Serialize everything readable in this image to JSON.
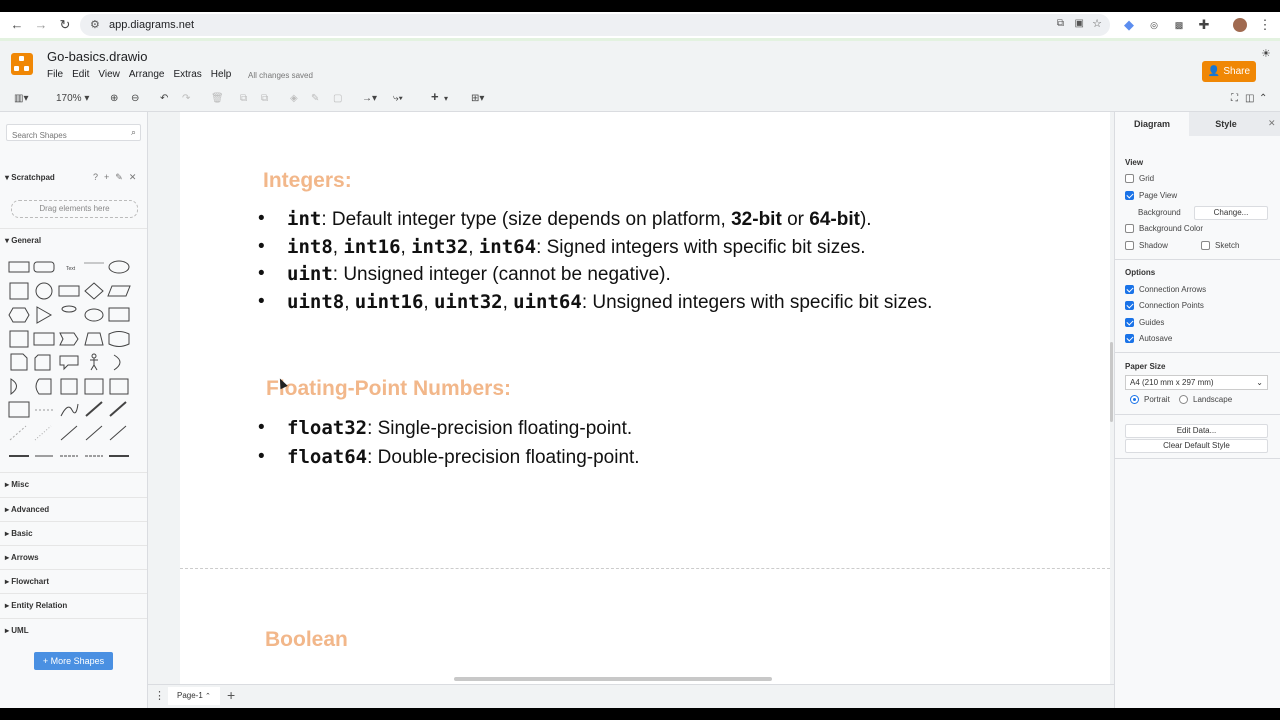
{
  "browser": {
    "url": "app.diagrams.net"
  },
  "app": {
    "doc_title": "Go-basics.drawio",
    "menu": [
      "File",
      "Edit",
      "View",
      "Arrange",
      "Extras",
      "Help"
    ],
    "save_status": "All changes saved",
    "share_label": "Share"
  },
  "toolbar": {
    "zoom": "170%"
  },
  "left": {
    "search_placeholder": "Search Shapes",
    "scratchpad": "Scratchpad",
    "drop_hint": "Drag elements here",
    "general": "General",
    "sections": [
      "Misc",
      "Advanced",
      "Basic",
      "Arrows",
      "Flowchart",
      "Entity Relation",
      "UML"
    ],
    "more_shapes": "More Shapes"
  },
  "doc": {
    "integers_heading": "Integers:",
    "int": {
      "code": "int",
      "text1": ": Default integer type (size depends on platform, ",
      "bold1": "32-bit",
      "text2": " or ",
      "bold2": "64-bit",
      "text3": ")."
    },
    "signed": {
      "c1": "int8",
      "c2": "int16",
      "c3": "int32",
      "c4": "int64",
      "sep": ", ",
      "text": ": Signed integers with specific bit sizes."
    },
    "uint": {
      "code": "uint",
      "text": ": Unsigned integer (cannot be negative)."
    },
    "unsigned": {
      "c1": "uint8",
      "c2": "uint16",
      "c3": "uint32",
      "c4": "uint64",
      "sep": ", ",
      "text": ": Unsigned integers with specific bit sizes."
    },
    "float_heading": "Floating-Point Numbers:",
    "float32": {
      "code": "float32",
      "text": ": Single-precision floating-point."
    },
    "float64": {
      "code": "float64",
      "text": ": Double-precision floating-point."
    },
    "boolean_heading": "Boolean"
  },
  "bottom": {
    "page_tab": "Page-1"
  },
  "right": {
    "tab_diagram": "Diagram",
    "tab_style": "Style",
    "view_label": "View",
    "grid": "Grid",
    "page_view": "Page View",
    "background": "Background",
    "change": "Change...",
    "background_color": "Background Color",
    "shadow": "Shadow",
    "sketch": "Sketch",
    "options_label": "Options",
    "connection_arrows": "Connection Arrows",
    "connection_points": "Connection Points",
    "guides": "Guides",
    "autosave": "Autosave",
    "paper_size_label": "Paper Size",
    "paper_size": "A4 (210 mm x 297 mm)",
    "portrait": "Portrait",
    "landscape": "Landscape",
    "edit_data": "Edit Data...",
    "clear_default_style": "Clear Default Style"
  },
  "colors": {
    "accent": "#f08705",
    "heading": "#f2b78a",
    "link_blue": "#1a73e8"
  }
}
